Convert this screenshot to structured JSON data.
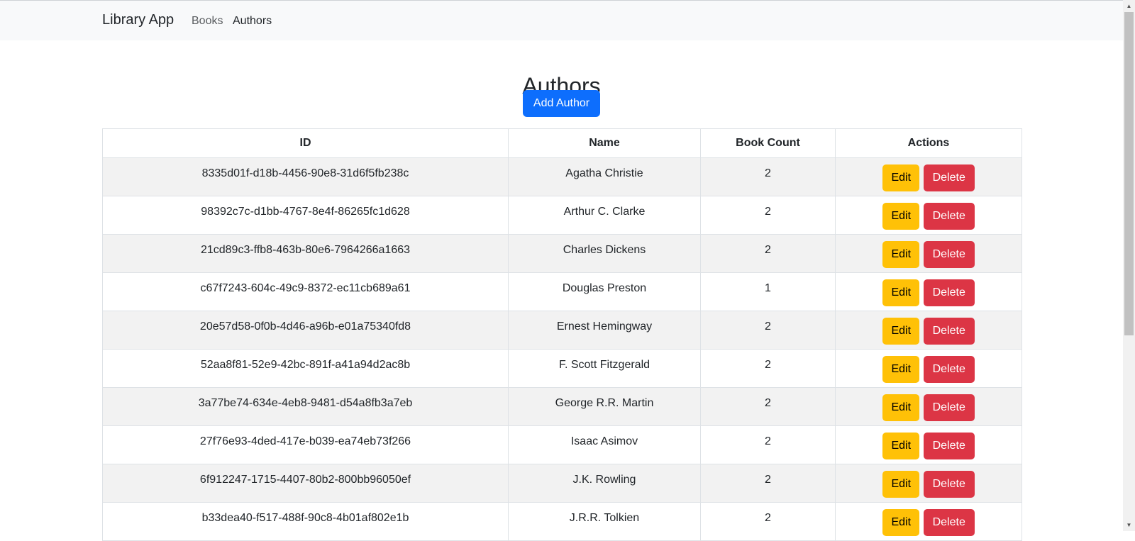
{
  "navbar": {
    "brand": "Library App",
    "links": [
      "Books",
      "Authors"
    ]
  },
  "page": {
    "title": "Authors",
    "add_button": "Add Author"
  },
  "table": {
    "headers": [
      "ID",
      "Name",
      "Book Count",
      "Actions"
    ],
    "edit_label": "Edit",
    "delete_label": "Delete",
    "rows": [
      {
        "id": "8335d01f-d18b-4456-90e8-31d6f5fb238c",
        "name": "Agatha Christie",
        "count": "2"
      },
      {
        "id": "98392c7c-d1bb-4767-8e4f-86265fc1d628",
        "name": "Arthur C. Clarke",
        "count": "2"
      },
      {
        "id": "21cd89c3-ffb8-463b-80e6-7964266a1663",
        "name": "Charles Dickens",
        "count": "2"
      },
      {
        "id": "c67f7243-604c-49c9-8372-ec11cb689a61",
        "name": "Douglas Preston",
        "count": "1"
      },
      {
        "id": "20e57d58-0f0b-4d46-a96b-e01a75340fd8",
        "name": "Ernest Hemingway",
        "count": "2"
      },
      {
        "id": "52aa8f81-52e9-42bc-891f-a41a94d2ac8b",
        "name": "F. Scott Fitzgerald",
        "count": "2"
      },
      {
        "id": "3a77be74-634e-4eb8-9481-d54a8fb3a7eb",
        "name": "George R.R. Martin",
        "count": "2"
      },
      {
        "id": "27f76e93-4ded-417e-b039-ea74eb73f266",
        "name": "Isaac Asimov",
        "count": "2"
      },
      {
        "id": "6f912247-1715-4407-80b2-800bb96050ef",
        "name": "J.K. Rowling",
        "count": "2"
      },
      {
        "id": "b33dea40-f517-488f-90c8-4b01af802e1b",
        "name": "J.R.R. Tolkien",
        "count": "2"
      }
    ]
  },
  "colors": {
    "primary": "#0d6efd",
    "warning": "#ffc107",
    "danger": "#dc3545",
    "navbar_bg": "#f8f9fa",
    "stripe": "#f2f2f2"
  },
  "icons": {
    "scroll_up": "scroll-up-arrow-icon",
    "scroll_down": "scroll-down-arrow-icon"
  }
}
